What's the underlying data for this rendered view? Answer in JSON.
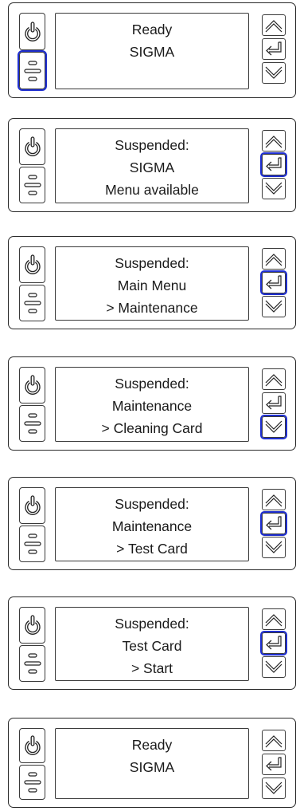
{
  "screens": [
    {
      "lines": [
        "Ready",
        "SIGMA",
        ""
      ],
      "highlight": "menu"
    },
    {
      "lines": [
        "Suspended:",
        "SIGMA",
        "Menu available"
      ],
      "highlight": "enter"
    },
    {
      "lines": [
        "Suspended:",
        "Main Menu",
        "> Maintenance"
      ],
      "highlight": "enter"
    },
    {
      "lines": [
        "Suspended:",
        "Maintenance",
        "> Cleaning Card"
      ],
      "highlight": "down"
    },
    {
      "lines": [
        "Suspended:",
        "Maintenance",
        "> Test Card"
      ],
      "highlight": "enter"
    },
    {
      "lines": [
        "Suspended:",
        "Test Card",
        "> Start"
      ],
      "highlight": "enter"
    },
    {
      "lines": [
        "Ready",
        "SIGMA",
        ""
      ],
      "highlight": ""
    }
  ],
  "icons": {
    "power": "power-icon",
    "menu": "menu-icon",
    "up": "up-arrow-icon",
    "enter": "enter-icon",
    "down": "down-arrow-icon"
  },
  "colors": {
    "highlight": "#1f2fd1",
    "outline": "#2a2a2a"
  }
}
